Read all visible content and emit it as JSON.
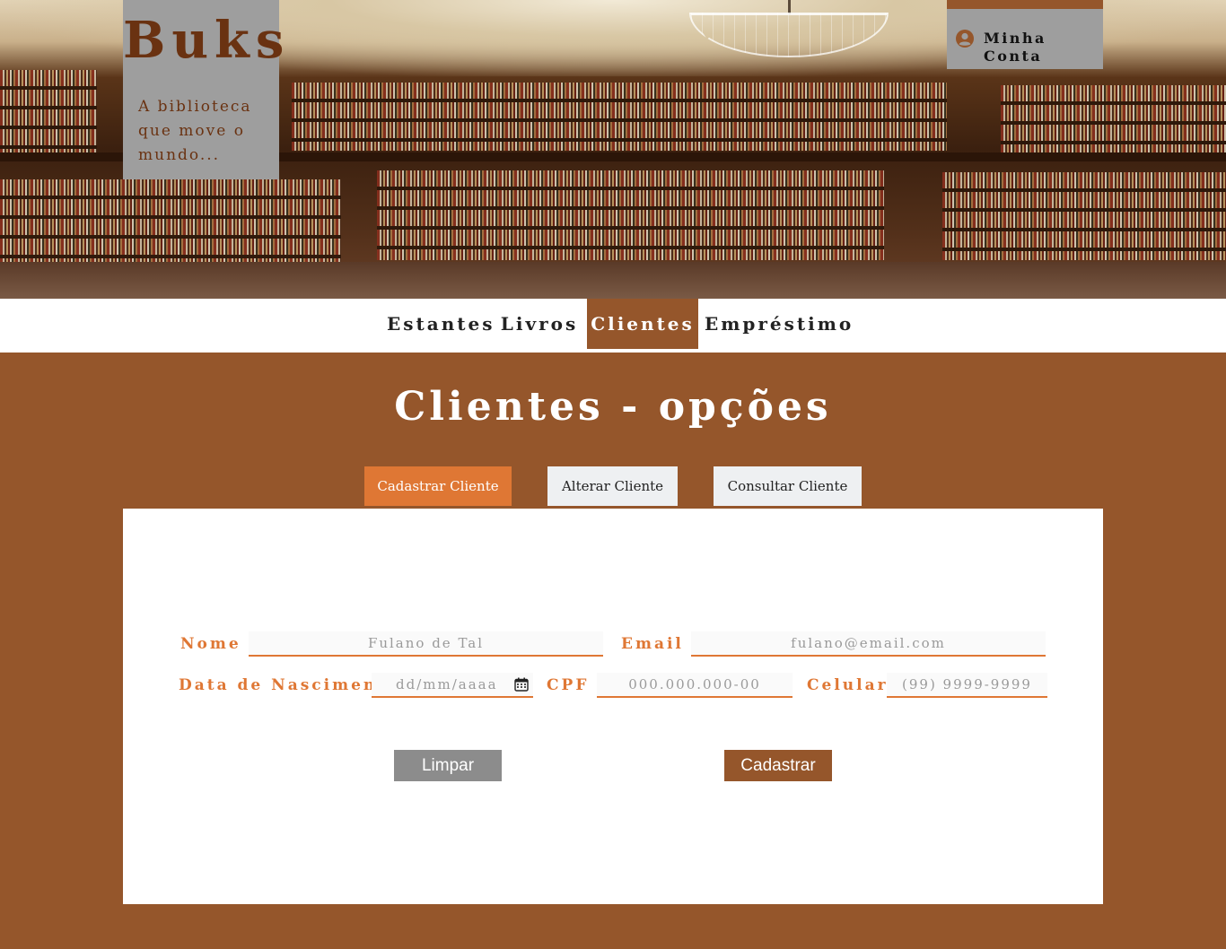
{
  "header": {
    "title": "Buks",
    "tagline": "A biblioteca que move o mundo...",
    "account": {
      "label": "Minha Conta",
      "icon": "user-circle-icon"
    }
  },
  "nav": {
    "items": [
      "Estantes",
      "Livros",
      "Clientes",
      "Empréstimo"
    ],
    "active": "Clientes"
  },
  "main": {
    "title": "Clientes - opções",
    "tabs": [
      "Cadastrar Cliente",
      "Alterar Cliente",
      "Consultar Cliente"
    ],
    "active_tab": "Cadastrar Cliente"
  },
  "form": {
    "nome": {
      "label": "Nome",
      "placeholder": "Fulano de Tal"
    },
    "email": {
      "label": "Email",
      "placeholder": "fulano@email.com"
    },
    "nascimento": {
      "label": "Data de Nascimento",
      "placeholder": "dd/mm/aaaa",
      "icon": "calendar-icon"
    },
    "cpf": {
      "label": "CPF",
      "placeholder": "000.000.000-00"
    },
    "celular": {
      "label": "Celular",
      "placeholder": "(99) 9999-9999"
    },
    "clear_label": "Limpar",
    "submit_label": "Cadastrar"
  },
  "colors": {
    "brand_brown": "#95562b",
    "accent_orange": "#df7734",
    "header_box_gray": "#9e9e9e",
    "logo_text": "#6a3211"
  }
}
